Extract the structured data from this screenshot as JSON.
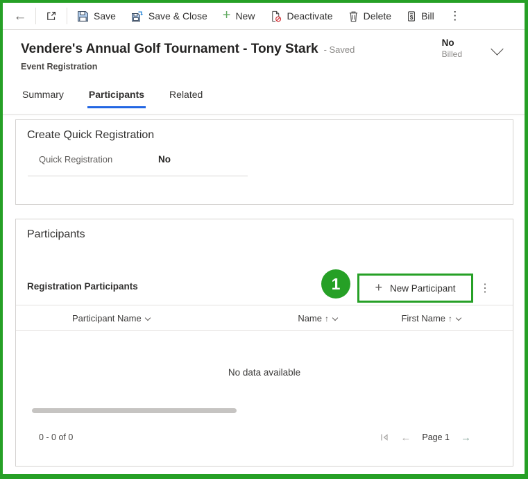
{
  "toolbar": {
    "back_glyph": "←",
    "save_label": "Save",
    "save_close_label": "Save & Close",
    "new_label": "New",
    "new_plus_glyph": "+",
    "deactivate_label": "Deactivate",
    "delete_label": "Delete",
    "bill_label": "Bill",
    "overflow_glyph": "⋮"
  },
  "header": {
    "title": "Vendere's Annual Golf Tournament - Tony Stark",
    "saved_suffix": "- Saved",
    "entity": "Event Registration",
    "billed_value": "No",
    "billed_label": "Billed"
  },
  "tabs": {
    "items": [
      {
        "label": "Summary",
        "active": false
      },
      {
        "label": "Participants",
        "active": true
      },
      {
        "label": "Related",
        "active": false
      }
    ]
  },
  "quick_registration": {
    "section_title": "Create Quick Registration",
    "field_label": "Quick Registration",
    "field_value": "No"
  },
  "participants": {
    "section_title": "Participants",
    "subgrid_title": "Registration Participants",
    "new_button_plus": "+",
    "new_button_label": "New Participant",
    "overflow_glyph": "⋮",
    "columns": [
      {
        "label": "Participant Name",
        "sort": ""
      },
      {
        "label": "Name",
        "sort": "↑"
      },
      {
        "label": "First Name",
        "sort": "↑"
      }
    ],
    "empty_text": "No data available",
    "footer": {
      "count": "0 - 0 of 0",
      "page": "Page 1",
      "prev_glyph": "←",
      "next_glyph": "→"
    }
  },
  "annotation": {
    "step": "1"
  },
  "colors": {
    "annotation_green": "#26a026",
    "tab_underline_blue": "#2266e3",
    "deactivate_red": "#d13438",
    "save_icon_blue": "#b7d3f3"
  }
}
